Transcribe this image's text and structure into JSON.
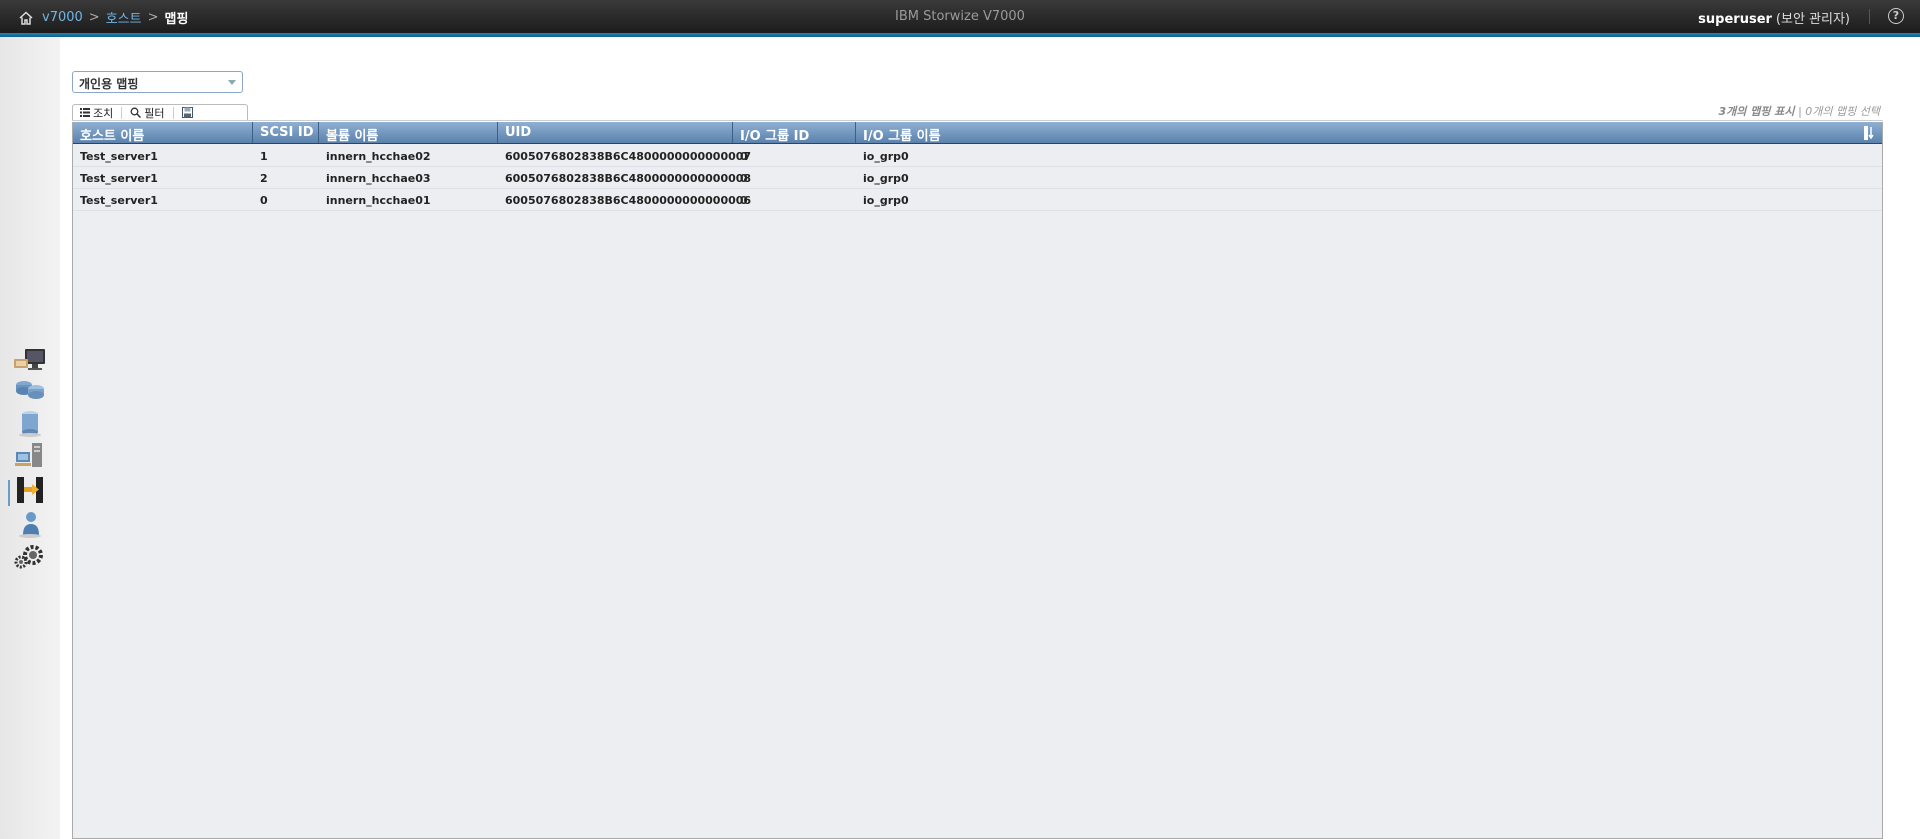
{
  "header": {
    "breadcrumb": [
      "v7000",
      "호스트",
      "맵핑"
    ],
    "breadcrumb_sep": ">",
    "app_title": "IBM Storwize V7000",
    "user_name": "superuser",
    "user_role": "(보안 관리자)",
    "help": "?"
  },
  "sidebar": {
    "items": [
      "monitoring-icon",
      "pools-icon",
      "volumes-icon",
      "hosts-icon",
      "copy-services-icon",
      "access-icon",
      "settings-icon"
    ],
    "selected": "hosts-icon"
  },
  "view_select": {
    "value": "개인용 맵핑"
  },
  "toolbar": {
    "actions_label": "조치",
    "filter_label": "필터"
  },
  "status": {
    "shown": "3개의 맵핑 표시",
    "sep": "|",
    "selected": "0개의 맵핑 선택"
  },
  "table": {
    "columns": [
      "호스트 이름",
      "SCSI ID",
      "볼륨 이름",
      "UID",
      "I/O 그룹 ID",
      "I/O 그룹 이름"
    ],
    "rows": [
      [
        "Test_server1",
        "1",
        "innern_hcchae02",
        "6005076802838B6C4800000000000007",
        "0",
        "io_grp0"
      ],
      [
        "Test_server1",
        "2",
        "innern_hcchae03",
        "6005076802838B6C4800000000000008",
        "0",
        "io_grp0"
      ],
      [
        "Test_server1",
        "0",
        "innern_hcchae01",
        "6005076802838B6C4800000000000006",
        "0",
        "io_grp0"
      ]
    ]
  }
}
